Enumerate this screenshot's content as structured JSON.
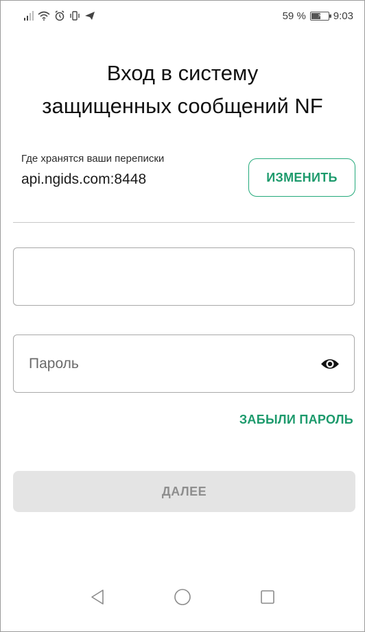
{
  "status_bar": {
    "battery_text": "59 %",
    "battery_level": 0.59,
    "time": "9:03",
    "icons": [
      "signal-icon",
      "wifi-icon",
      "alarm-icon",
      "vibrate-icon",
      "telegram-icon"
    ]
  },
  "title": {
    "line1": "Вход в систему",
    "line2": "защищенных сообщений NF"
  },
  "server": {
    "caption": "Где хранятся ваши переписки",
    "address": "api.ngids.com:8448",
    "change_label": "ИЗМЕНИТЬ"
  },
  "login": {
    "value": "",
    "placeholder": ""
  },
  "password": {
    "value": "",
    "placeholder": "Пароль"
  },
  "forgot_label": "ЗАБЫЛИ ПАРОЛЬ",
  "next_label": "ДАЛЕЕ",
  "colors": {
    "accent": "#1c9a6c",
    "disabled_bg": "#e4e4e4",
    "disabled_text": "#8e8e8e"
  },
  "nav": [
    "back-icon",
    "home-icon",
    "recents-icon"
  ]
}
